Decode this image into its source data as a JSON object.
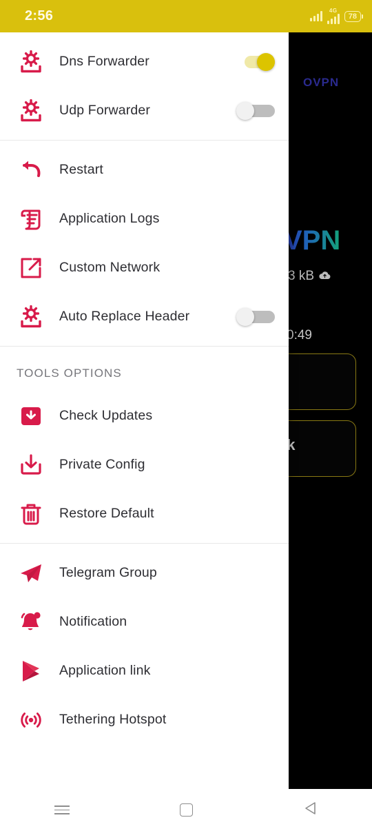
{
  "status_bar": {
    "time": "2:56",
    "network_label": "4G",
    "battery_level": "78",
    "signal_icon": "signal-bars-icon",
    "network_icon": "network-4g-icon",
    "battery_icon": "battery-icon",
    "background_color": "#d9c00d"
  },
  "drawer": {
    "accent_color": "#d81b4a",
    "sections": [
      {
        "name": "forwarder-section",
        "items": [
          {
            "label": "Dns Forwarder",
            "icon": "gear-tray-icon",
            "toggle": "on"
          },
          {
            "label": "Udp Forwarder",
            "icon": "gear-tray-icon",
            "toggle": "off"
          }
        ]
      },
      {
        "name": "system-section",
        "items": [
          {
            "label": "Restart",
            "icon": "restart-arrow-icon",
            "toggle": null
          },
          {
            "label": "Application Logs",
            "icon": "logs-scroll-icon",
            "toggle": null
          },
          {
            "label": "Custom Network",
            "icon": "external-link-box-icon",
            "toggle": null
          },
          {
            "label": "Auto Replace Header",
            "icon": "gear-tray-icon",
            "toggle": "off"
          }
        ]
      },
      {
        "header": "TOOLS OPTIONS",
        "name": "tools-options-section",
        "items": [
          {
            "label": "Check Updates",
            "icon": "update-download-box-icon",
            "toggle": null
          },
          {
            "label": "Private Config",
            "icon": "download-tray-icon",
            "toggle": null
          },
          {
            "label": "Restore Default",
            "icon": "trash-icon",
            "toggle": null
          }
        ]
      },
      {
        "name": "links-section",
        "items": [
          {
            "label": "Telegram Group",
            "icon": "telegram-plane-icon",
            "toggle": null
          },
          {
            "label": "Notification",
            "icon": "bell-icon",
            "toggle": null
          },
          {
            "label": "Application link",
            "icon": "play-store-icon",
            "toggle": null
          },
          {
            "label": "Tethering Hotspot",
            "icon": "hotspot-broadcast-icon",
            "toggle": null
          }
        ]
      }
    ]
  },
  "background_app": {
    "protocol_label": "OVPN",
    "title": "VPN",
    "data_usage": "3 kB",
    "data_icon": "cloud-upload-icon",
    "timer": "0:49",
    "card_text": "ck",
    "card_border_color": "#8a7a14"
  },
  "nav_bar": {
    "recents_icon": "menu-lines-icon",
    "home_icon": "home-square-icon",
    "back_icon": "back-triangle-icon"
  }
}
